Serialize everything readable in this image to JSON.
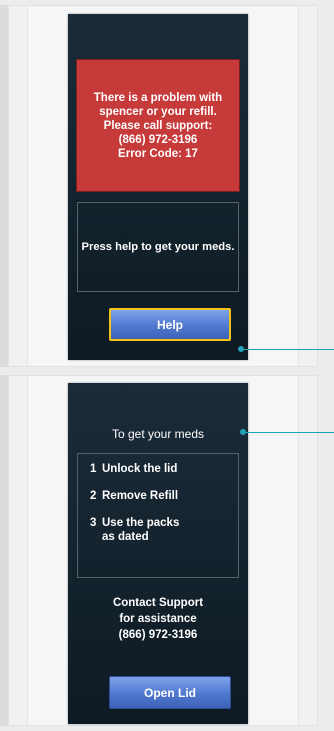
{
  "screen1": {
    "error_lines": [
      "There is a problem with",
      "spencer or your refill.",
      "Please call support:",
      "(866) 972-3196",
      "Error Code: 17"
    ],
    "help_message": "Press help to get your meds.",
    "help_button_label": "Help"
  },
  "screen2": {
    "title": "To get your meds",
    "steps": [
      {
        "number": "1",
        "lines": [
          "Unlock the lid"
        ]
      },
      {
        "number": "2",
        "lines": [
          "Remove Refill"
        ]
      },
      {
        "number": "3",
        "lines": [
          "Use the packs",
          "as dated"
        ]
      }
    ],
    "contact_lines": [
      "Contact Support",
      "for assistance",
      "(866) 972-3196"
    ],
    "open_button_label": "Open Lid"
  },
  "colors": {
    "error_red": "#c63a3a",
    "button_blue": "#4f78cf",
    "help_button_border": "#f2c417",
    "callout_teal": "#20a3b6",
    "screen_dark": "#15242f"
  }
}
